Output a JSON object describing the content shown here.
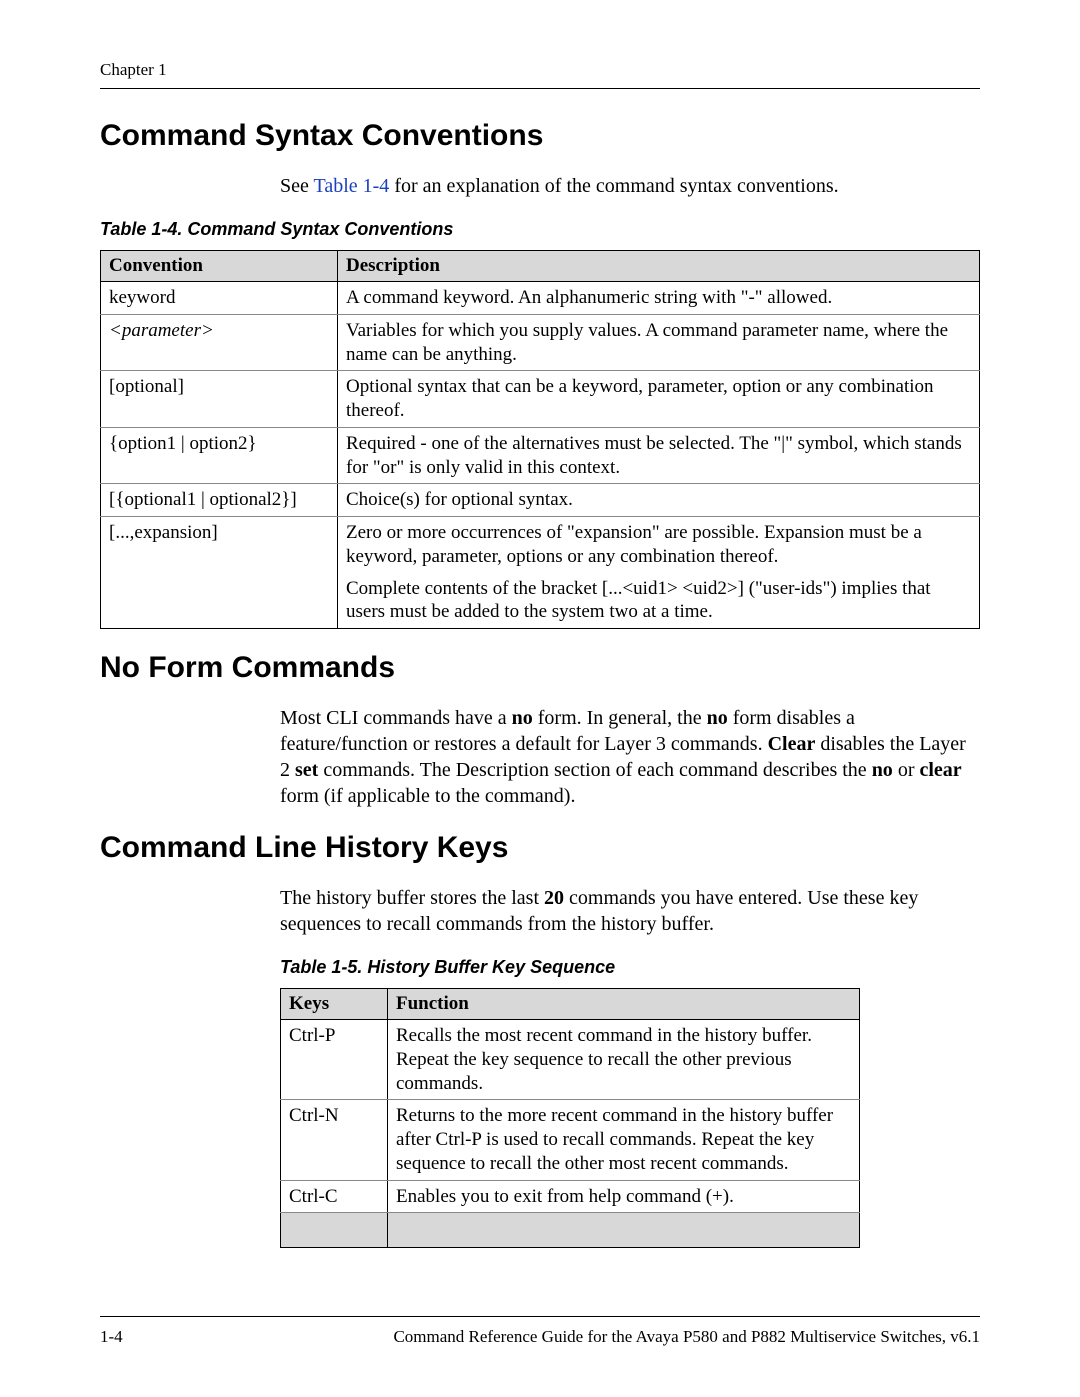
{
  "header": {
    "chapter": "Chapter 1"
  },
  "sections": {
    "syntax": {
      "title": "Command Syntax Conventions",
      "intro_pre": "See ",
      "intro_link": "Table 1-4",
      "intro_post": " for an explanation of the command syntax conventions."
    },
    "noform": {
      "title": "No Form Commands",
      "para": {
        "p1": "Most CLI commands have a ",
        "b1": "no",
        "p2": " form. In general, the ",
        "b2": "no",
        "p3": " form disables a feature/function or restores a default for Layer 3 commands. ",
        "b3": "Clear",
        "p4": " disables the Layer 2 ",
        "b4": "set",
        "p5": " commands. The Description section of each command describes the ",
        "b5": "no",
        "p6": " or ",
        "b6": "clear",
        "p7": " form (if applicable to the command)."
      }
    },
    "history": {
      "title": "Command Line History Keys",
      "para": {
        "p1": "The history buffer stores the last ",
        "b1": "20",
        "p2": " commands you have entered. Use these key sequences to recall commands from the history buffer."
      }
    }
  },
  "table4": {
    "caption": "Table 1-4. Command Syntax Conventions",
    "headers": {
      "c1": "Convention",
      "c2": "Description"
    },
    "rows": [
      {
        "conv": "keyword",
        "desc": "A command keyword. An alphanumeric string with \"-\" allowed."
      },
      {
        "conv": "<parameter>",
        "desc": "Variables for which you supply values. A command parameter name, where the name can be anything."
      },
      {
        "conv": "[optional]",
        "desc": "Optional syntax that can be a keyword, parameter, option or any combination thereof."
      },
      {
        "conv": "{option1 | option2}",
        "desc": "Required - one of the alternatives must be selected. The \"|\" symbol, which stands for \"or\" is only valid in this context."
      },
      {
        "conv": "[{optional1 | optional2}]",
        "desc": "Choice(s) for optional syntax."
      },
      {
        "conv": "[...,expansion]",
        "desc": "Zero or more occurrences of \"expansion\" are possible. Expansion must be a keyword, parameter, options or any combination thereof."
      }
    ],
    "extra": "Complete contents of the bracket [...<uid1> <uid2>] (\"user-ids\") implies that users must be added to the system two at a time."
  },
  "table5": {
    "caption": "Table 1-5. History Buffer Key Sequence",
    "headers": {
      "c1": "Keys",
      "c2": "Function"
    },
    "rows": [
      {
        "k": "Ctrl-P",
        "f": "Recalls the most recent command in the history buffer. Repeat the key sequence to recall the other previous commands."
      },
      {
        "k": "Ctrl-N",
        "f": "Returns to the more recent command in the history buffer after Ctrl-P is used to recall commands. Repeat the key sequence to recall the other most recent commands."
      },
      {
        "k": "Ctrl-C",
        "f": "Enables you to exit from help command (+)."
      }
    ]
  },
  "footer": {
    "page": "1-4",
    "doc": "Command Reference Guide for the Avaya P580 and P882 Multiservice Switches, v6.1"
  }
}
